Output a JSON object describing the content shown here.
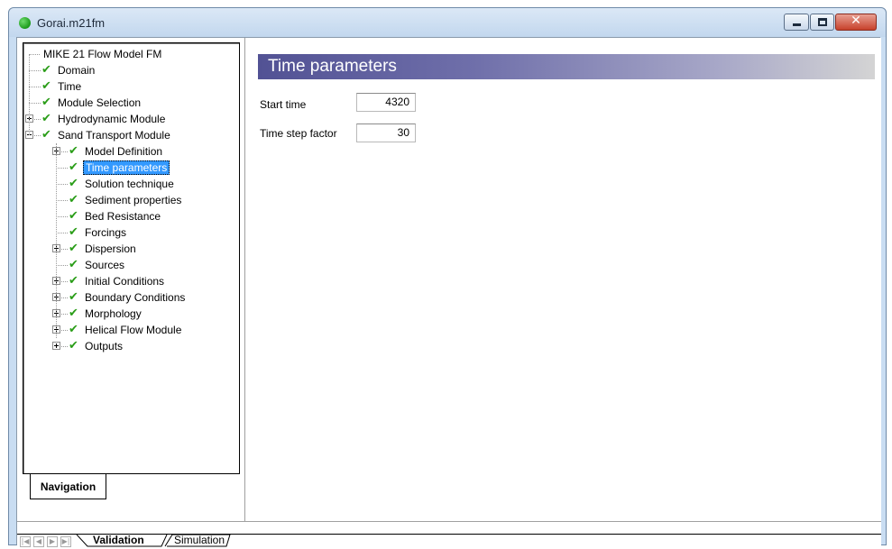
{
  "window": {
    "title": "Gorai.m21fm",
    "controls": {
      "minimize": "minimize",
      "maximize": "maximize",
      "close": "✕"
    }
  },
  "tree": {
    "items": [
      {
        "label": "MIKE 21 Flow Model FM",
        "level": 0,
        "check": false,
        "expander": "none",
        "selected": false
      },
      {
        "label": "Domain",
        "level": 1,
        "check": true,
        "expander": "none",
        "selected": false
      },
      {
        "label": "Time",
        "level": 1,
        "check": true,
        "expander": "none",
        "selected": false
      },
      {
        "label": "Module Selection",
        "level": 1,
        "check": true,
        "expander": "none",
        "selected": false
      },
      {
        "label": "Hydrodynamic Module",
        "level": 1,
        "check": true,
        "expander": "plus",
        "selected": false
      },
      {
        "label": "Sand Transport Module",
        "level": 1,
        "check": true,
        "expander": "minus",
        "selected": false
      },
      {
        "label": "Model Definition",
        "level": 2,
        "check": true,
        "expander": "plus",
        "selected": false
      },
      {
        "label": "Time parameters",
        "level": 2,
        "check": true,
        "expander": "none",
        "selected": true
      },
      {
        "label": "Solution technique",
        "level": 2,
        "check": true,
        "expander": "none",
        "selected": false
      },
      {
        "label": "Sediment properties",
        "level": 2,
        "check": true,
        "expander": "none",
        "selected": false
      },
      {
        "label": "Bed Resistance",
        "level": 2,
        "check": true,
        "expander": "none",
        "selected": false
      },
      {
        "label": "Forcings",
        "level": 2,
        "check": true,
        "expander": "none",
        "selected": false
      },
      {
        "label": "Dispersion",
        "level": 2,
        "check": true,
        "expander": "plus",
        "selected": false
      },
      {
        "label": "Sources",
        "level": 2,
        "check": true,
        "expander": "none",
        "selected": false
      },
      {
        "label": "Initial Conditions",
        "level": 2,
        "check": true,
        "expander": "plus",
        "selected": false
      },
      {
        "label": "Boundary Conditions",
        "level": 2,
        "check": true,
        "expander": "plus",
        "selected": false
      },
      {
        "label": "Morphology",
        "level": 2,
        "check": true,
        "expander": "plus",
        "selected": false
      },
      {
        "label": "Helical Flow Module",
        "level": 2,
        "check": true,
        "expander": "plus",
        "selected": false
      },
      {
        "label": "Outputs",
        "level": 2,
        "check": true,
        "expander": "plus",
        "selected": false
      }
    ],
    "check_glyph": "✔"
  },
  "nav_tab": {
    "label": "Navigation"
  },
  "content": {
    "title": "Time parameters",
    "fields": [
      {
        "label": "Start time",
        "value": "4320"
      },
      {
        "label": "Time step factor",
        "value": "30"
      }
    ]
  },
  "bottom_tabs": {
    "tabs": [
      {
        "label": "Validation",
        "active": true
      },
      {
        "label": "Simulation",
        "active": false
      }
    ],
    "arrows": [
      "|◀",
      "◀",
      "▶",
      "▶|"
    ]
  },
  "colors": {
    "check_green": "#2a9d18",
    "selection_blue": "#3399ff",
    "header_gradient_start": "#525294",
    "header_gradient_end": "#d4d4d4"
  }
}
